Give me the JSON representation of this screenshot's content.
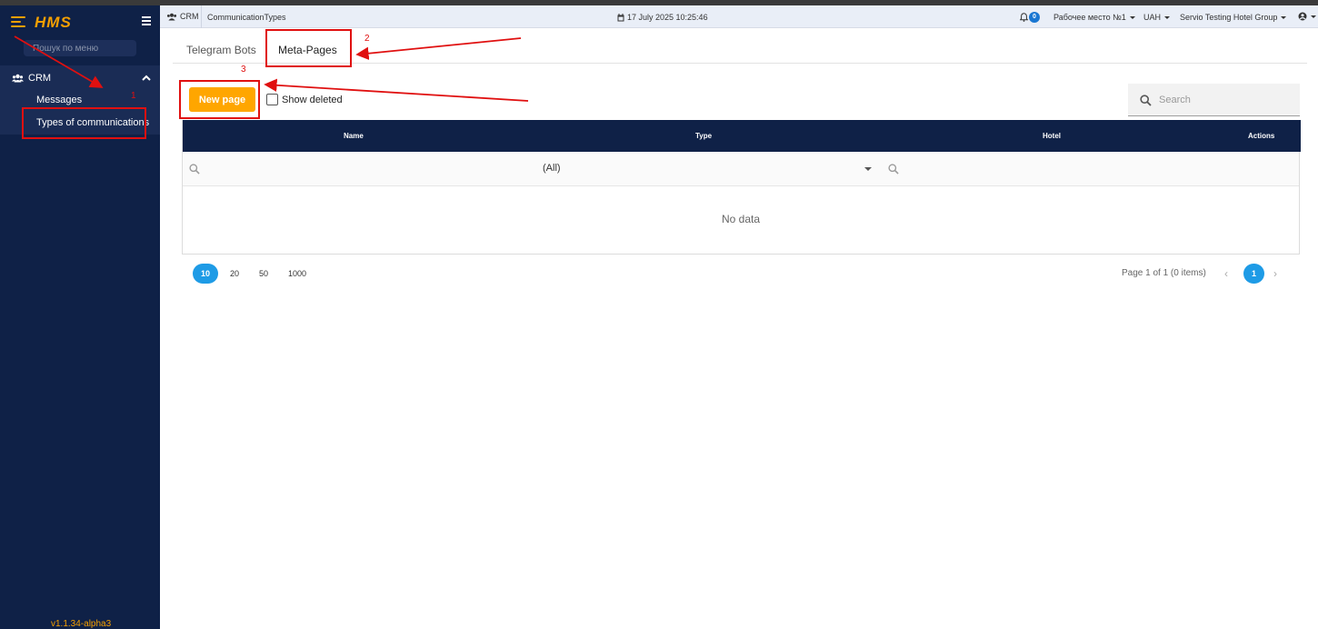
{
  "sidebar": {
    "brand": "HMS",
    "menu_search_placeholder": "Пошук по меню",
    "group_label": "CRM",
    "items": [
      {
        "label": "Messages"
      },
      {
        "label": "Types of communications"
      }
    ],
    "version": "v1.1.34-alpha3"
  },
  "header": {
    "module": "CRM",
    "page": "CommunicationTypes",
    "datetime": "17 July 2025 10:25:46",
    "notifications_count": "0",
    "workplace": "Рабочее место №1",
    "currency": "UAH",
    "organization": "Servio Testing Hotel Group"
  },
  "tabs": [
    {
      "label": "Telegram Bots",
      "active": false
    },
    {
      "label": "Meta-Pages",
      "active": true
    }
  ],
  "toolbar": {
    "new_button": "New page",
    "show_deleted_label": "Show deleted",
    "search_placeholder": "Search"
  },
  "grid": {
    "columns": [
      "Name",
      "Type",
      "Hotel",
      "Actions"
    ],
    "type_filter_value": "(All)",
    "empty_text": "No data"
  },
  "pager": {
    "page_sizes": [
      "10",
      "20",
      "50",
      "1000"
    ],
    "info": "Page 1 of 1 (0 items)",
    "current_page": "1"
  },
  "annotations": [
    "1",
    "2",
    "3"
  ],
  "colors": {
    "sidebar_bg": "#0f2147",
    "accent": "#ffa600",
    "pager_active": "#1e9be6",
    "annotation": "#e01010"
  }
}
